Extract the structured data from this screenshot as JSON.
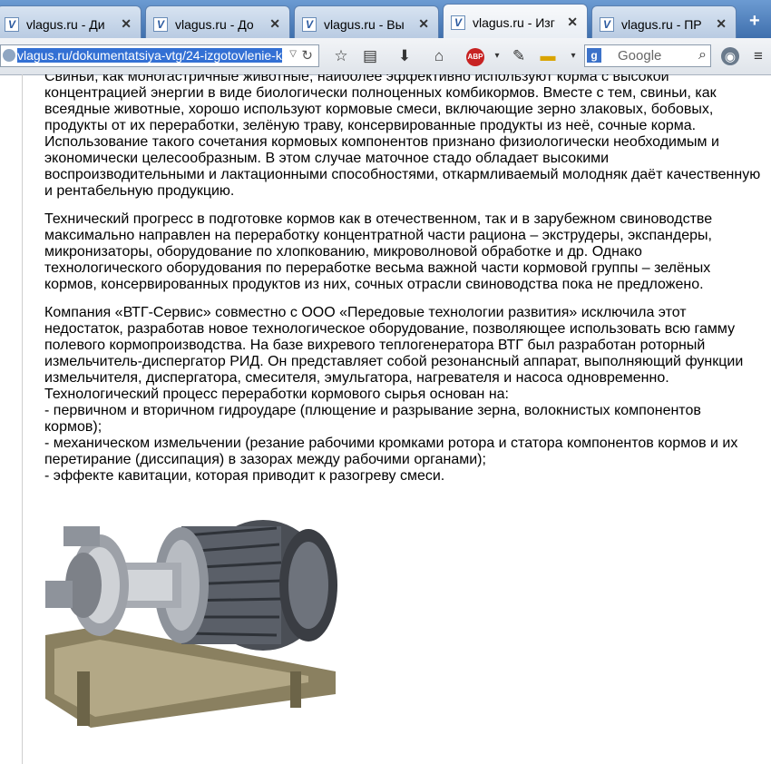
{
  "tabs": [
    {
      "title": "vlagus.ru - Ди"
    },
    {
      "title": "vlagus.ru - До"
    },
    {
      "title": "vlagus.ru - Вы"
    },
    {
      "title": "vlagus.ru - Изг"
    },
    {
      "title": "vlagus.ru - ПР"
    }
  ],
  "navbar": {
    "url": "vlagus.ru/dokumentatsiya-vtg/24-izgotovlenie-k",
    "search_placeholder": "Google"
  },
  "paragraphs": [
    "Свиньи, как моногастричные животные, наиболее эффективно используют корма с высокой концентрацией энергии в виде биологически полноценных комбикормов. Вместе с тем, свиньи, как всеядные животные, хорошо используют кормовые смеси, включающие зерно злаковых, бобовых, продукты от их переработки, зелёную траву, консервированные продукты из неё, сочные корма. Использование такого сочетания кормовых компонентов признано физиологически необходимым и экономически целесообразным. В этом случае маточное стадо обладает высокими воспроизводительными и лактационными способностями, откармливаемый молодняк даёт качественную и рентабельную продукцию.",
    "Технический прогресс в подготовке кормов как в отечественном, так и в зарубежном свиноводстве максимально направлен на переработку концентратной части рациона – экструдеры, экспандеры, микронизаторы, оборудование по хлопкованию, микроволновой обработке и др. Однако технологического оборудования по переработке весьма важной части кормовой группы – зелёных кормов, консервированных продуктов из них, сочных отрасли свиноводства пока не предложено.",
    "Компания «ВТГ-Сервис» совместно с ООО «Передовые технологии развития» исключила этот недостаток, разработав новое технологическое оборудование, позволяющее использовать всю гамму полевого кормопроизводства. На базе вихревого теплогенератора ВТГ был разработан роторный измельчитель-диспергатор РИД. Он представляет собой резонансный аппарат, выполняющий функции измельчителя, диспергатора, смесителя, эмульгатора, нагревателя и насоса одновременно. Технологический процесс переработки кормового сырья основан на:\n- первичном и вторичном гидроударе (плющение и разрывание зерна, волокнистых компонентов кормов);\n- механическом измельчении (резание рабочими кромками ротора и статора компонентов кормов и их перетирание (диссипация) в зазорах между рабочими органами);\n- эффекте кавитации, которая приводит к разогреву смеси."
  ]
}
